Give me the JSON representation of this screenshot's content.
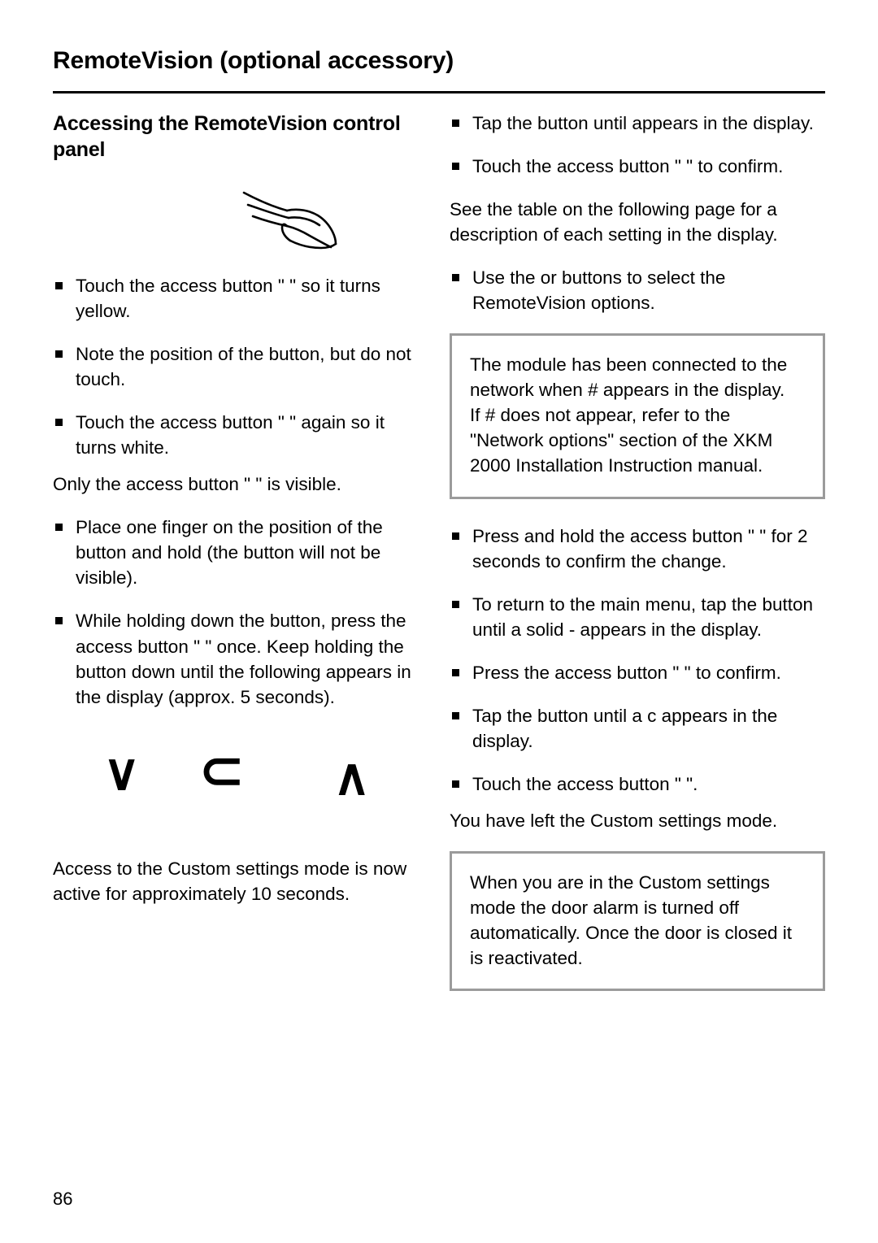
{
  "header": {
    "title": "RemoteVision (optional accessory)"
  },
  "left": {
    "section_title": "Accessing the RemoteVision control panel",
    "bullets_1": [
      "Touch the access button \"  \" so it turns yellow.",
      "Note the position of the     button, but do not touch.",
      "Touch the access button \"  \" again so it turns white."
    ],
    "para_only": "Only the access button \"  \" is visible.",
    "bullets_2": [
      "Place one finger on the position of the     button and hold (the     button will not be visible).",
      "While holding down the     button, press the access button \"  \" once. Keep holding the     button down until the following appears in the display (approx. 5 seconds)."
    ],
    "display_glyphs": [
      "∨",
      "⊂",
      "∧"
    ],
    "para_access": "Access to the Custom settings mode is now active for approximately 10 seconds."
  },
  "right": {
    "bullets_1": [
      "Tap the      button until      appears in the display.",
      "Touch the access button \"  \" to confirm."
    ],
    "para_see_table": "See the table on the following page for a description of each setting in the display.",
    "bullets_2": [
      "Use the      or      buttons to select the RemoteVision options."
    ],
    "note_1": [
      "The module has been connected to the network when   # appears in the display.",
      "If   # does not appear, refer to the \"Network options\" section of the XKM 2000 Installation Instruction manual."
    ],
    "bullets_3": [
      "Press and hold the access button \"  \" for 2 seconds to confirm the change.",
      "To return to the main menu, tap the     button until a solid   - appears in the display.",
      "Press the access button \"  \" to confirm.",
      "Tap the     button until a c appears in the display.",
      "Touch the access button \"  \"."
    ],
    "para_left_mode": "You have left the Custom settings mode.",
    "note_2": [
      "When you are in the Custom settings mode the door alarm is turned off automatically. Once the door is closed it is reactivated."
    ]
  },
  "footer": {
    "page_number": "86"
  }
}
